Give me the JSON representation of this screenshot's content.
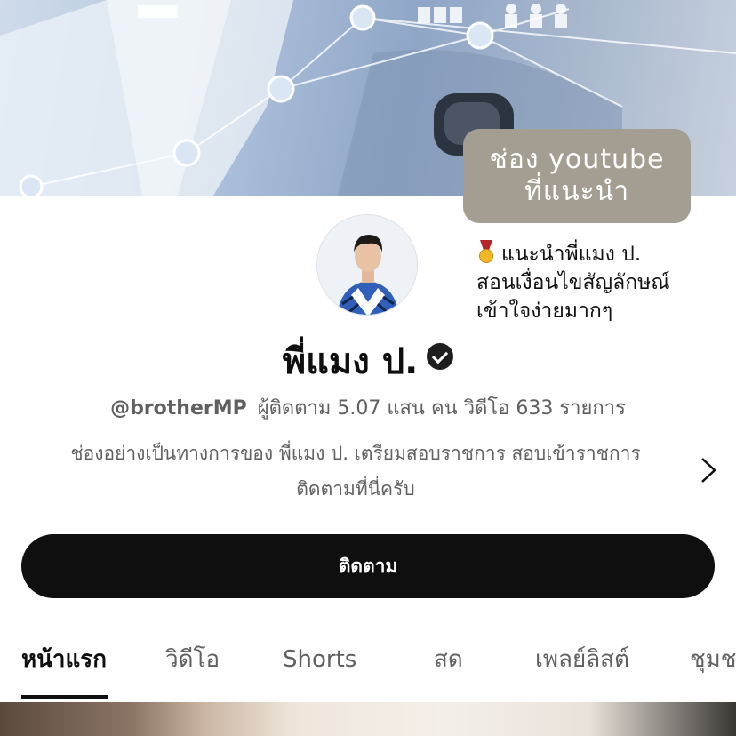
{
  "overlay": {
    "sticker_line1": "ช่อง youtube",
    "sticker_line2": "ที่แนะนำ",
    "note_line1": "แนะนำพี่แมง ป.",
    "note_line2": "สอนเงื่อนไขสัญลักษณ์",
    "note_line3": "เข้าใจง่ายมากๆ",
    "note_icon": "medal-icon"
  },
  "channel": {
    "name": "พี่แมง ป.",
    "verified_icon": "verified-check-icon",
    "handle": "@brotherMP",
    "stats": "ผู้ติดตาม 5.07 แสน คน  วิดีโอ 633 รายการ",
    "description_line1": "ช่องอย่างเป็นทางการของ พี่แมง ป. เตรียมสอบราชการ สอบเข้าราชการ",
    "description_line2": "ติดตามที่นี่ครับ",
    "more_icon": "chevron-right-icon"
  },
  "subscribe_label": "ติดตาม",
  "tabs": [
    {
      "label": "หน้าแรก",
      "active": true
    },
    {
      "label": "วิดีโอ",
      "active": false
    },
    {
      "label": "Shorts",
      "active": false
    },
    {
      "label": "สด",
      "active": false
    },
    {
      "label": "เพลย์ลิสต์",
      "active": false
    },
    {
      "label": "ชุมช",
      "active": false
    }
  ],
  "colors": {
    "sticker_bg": "#a39d92",
    "button_bg": "#0f0f0f",
    "secondary_text": "#606060"
  }
}
